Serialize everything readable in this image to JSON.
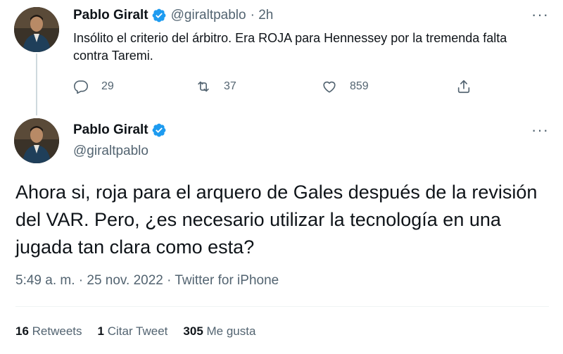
{
  "parent_tweet": {
    "name": "Pablo Giralt",
    "handle": "@giraltpablo",
    "time": "· 2h",
    "text": "Insólito el criterio del árbitro. Era ROJA para Hennessey por la tremenda falta contra Taremi.",
    "replies": "29",
    "retweets": "37",
    "likes": "859",
    "more_label": "···"
  },
  "main_tweet": {
    "name": "Pablo Giralt",
    "handle": "@giraltpablo",
    "more_label": "···",
    "text": "Ahora si, roja para el arquero de Gales después de la revisión del VAR. Pero, ¿es necesario utilizar la tecnología en una jugada tan clara como esta?",
    "meta": "5:49 a. m. · 25 nov. 2022 · Twitter for iPhone",
    "stats": {
      "retweets_count": "16",
      "retweets_label": "Retweets",
      "quotes_count": "1",
      "quotes_label": "Citar Tweet",
      "likes_count": "305",
      "likes_label": "Me gusta"
    }
  },
  "icons": {
    "verified": "verified-badge-icon",
    "reply": "reply-icon",
    "retweet": "retweet-icon",
    "like": "heart-icon",
    "share": "share-icon"
  },
  "colors": {
    "verified": "#1d9bf0",
    "secondary_text": "#536471",
    "primary_text": "#0f1419",
    "thread_line": "#cfd9de"
  }
}
